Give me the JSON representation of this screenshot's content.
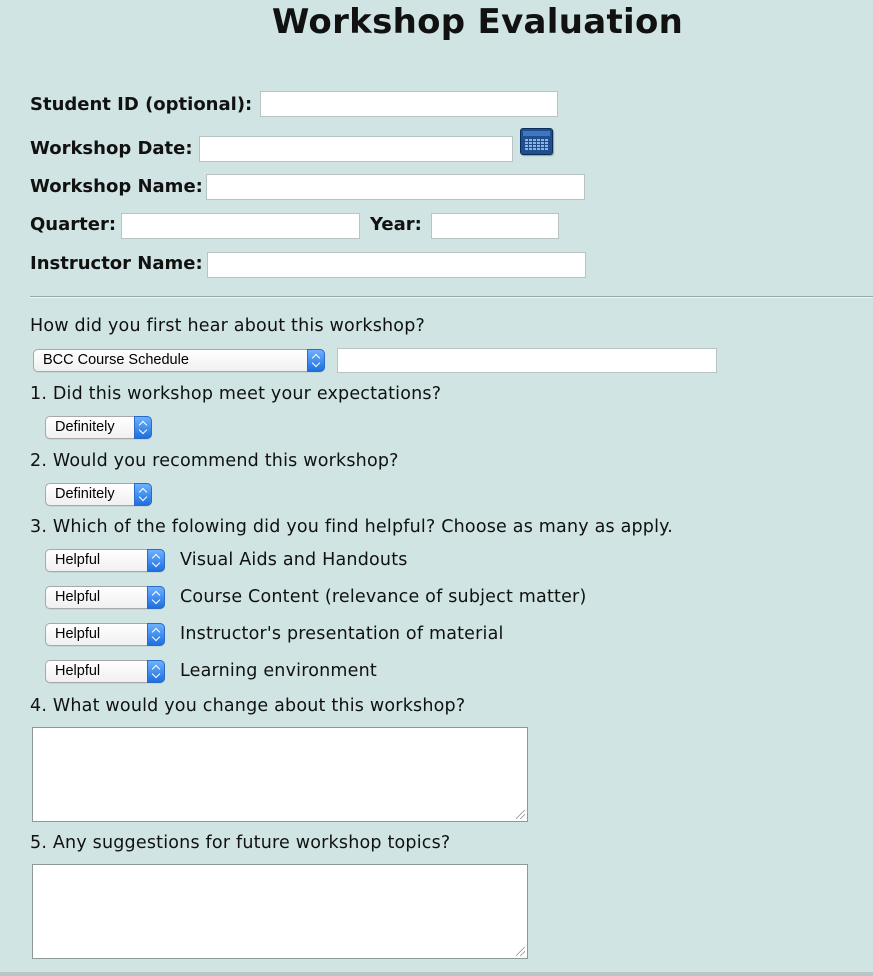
{
  "page": {
    "title": "Workshop Evaluation"
  },
  "info": {
    "student_id_label": "Student ID (optional):",
    "workshop_date_label": "Workshop Date:",
    "workshop_name_label": "Workshop Name:",
    "quarter_label": "Quarter:",
    "year_label": "Year:",
    "instructor_label": "Instructor Name:",
    "student_id_value": "",
    "workshop_date_value": "",
    "workshop_name_value": "",
    "quarter_value": "",
    "year_value": "",
    "instructor_value": ""
  },
  "source": {
    "question": "How did you first hear about this workshop?",
    "selected": "BCC Course Schedule",
    "other_value": ""
  },
  "q1": {
    "question": "1. Did this workshop meet your expectations?",
    "selected": "Definitely"
  },
  "q2": {
    "question": "2. Would you recommend this workshop?",
    "selected": "Definitely"
  },
  "q3": {
    "question": "3. Which of the folowing did you find helpful? Choose as many as apply.",
    "items": [
      {
        "selected": "Helpful",
        "label": "Visual Aids and Handouts"
      },
      {
        "selected": "Helpful",
        "label": "Course Content (relevance of subject matter)"
      },
      {
        "selected": "Helpful",
        "label": "Instructor's presentation of material"
      },
      {
        "selected": "Helpful",
        "label": "Learning environment"
      }
    ]
  },
  "q4": {
    "question": "4. What would you change about this workshop?",
    "value": ""
  },
  "q5": {
    "question": "5. Any suggestions for future workshop topics?",
    "value": ""
  },
  "icons": {
    "calendar": "calendar-icon"
  },
  "colors": {
    "background": "#cfe4e3",
    "select_accent": "#1d6fe0",
    "calendar": "#1f4f8c"
  }
}
